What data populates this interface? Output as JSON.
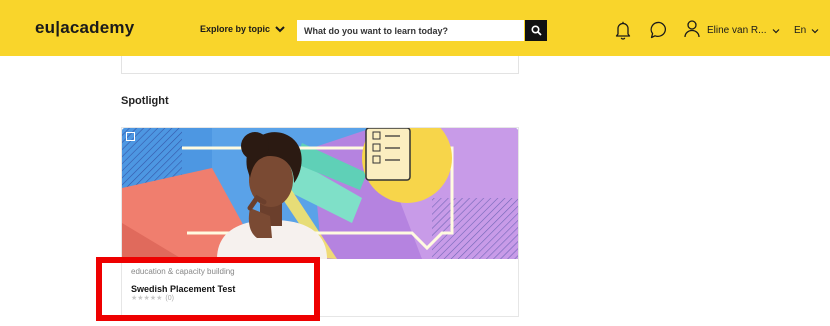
{
  "header": {
    "logo": "eu|academy",
    "explore_label": "Explore by topic",
    "search_placeholder": "What do you want to learn today?",
    "user_name": "Eline van R...",
    "language": "En"
  },
  "icons": {
    "explore": "chevron-down-icon",
    "search": "search-icon",
    "notifications": "bell-icon",
    "messages": "chat-bubble-icon",
    "user": "user-icon",
    "user_menu": "chevron-down-icon",
    "language_menu": "chevron-down-icon",
    "bookmark": "bookmark-icon"
  },
  "main": {
    "section_title": "Spotlight",
    "card": {
      "category": "education & capacity building",
      "title": "Swedish Placement Test",
      "stars": "★★★★★",
      "rating_count": "(0)"
    }
  },
  "colors": {
    "brand_yellow": "#f9d52b",
    "highlight_red": "#ee0000"
  }
}
